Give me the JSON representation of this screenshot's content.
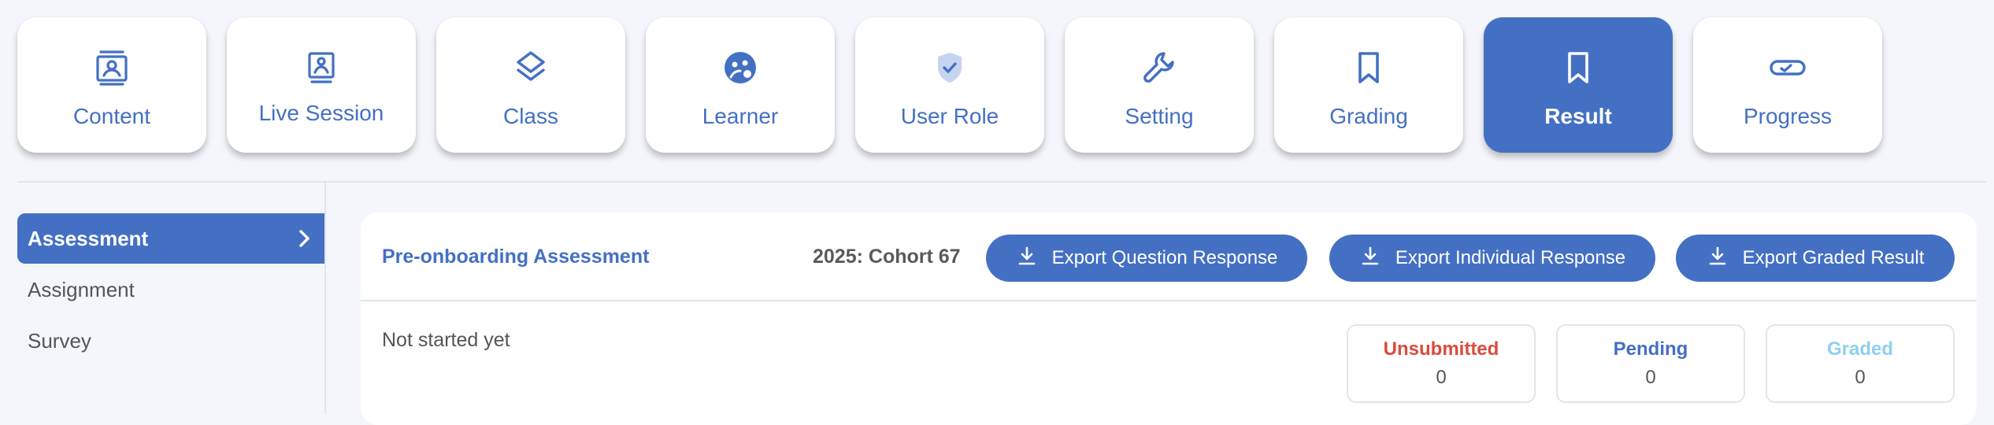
{
  "tabs": [
    {
      "label": "Content",
      "icon": "contacts-book-icon",
      "active": false
    },
    {
      "label": "Live Session",
      "icon": "presentation-user-icon",
      "active": false
    },
    {
      "label": "Class",
      "icon": "layers-icon",
      "active": false
    },
    {
      "label": "Learner",
      "icon": "learner-face-icon",
      "active": false
    },
    {
      "label": "User Role",
      "icon": "shield-check-icon",
      "active": false
    },
    {
      "label": "Setting",
      "icon": "wrench-icon",
      "active": false
    },
    {
      "label": "Grading",
      "icon": "bookmark-icon",
      "active": false
    },
    {
      "label": "Result",
      "icon": "bookmark-icon",
      "active": true
    },
    {
      "label": "Progress",
      "icon": "toggle-check-icon",
      "active": false
    }
  ],
  "sidebar": {
    "items": [
      {
        "label": "Assessment",
        "active": true
      },
      {
        "label": "Assignment",
        "active": false
      },
      {
        "label": "Survey",
        "active": false
      }
    ]
  },
  "assessment": {
    "title": "Pre-onboarding Assessment",
    "cohort": "2025: Cohort 67",
    "buttons": {
      "export_question": "Export Question Response",
      "export_individual": "Export Individual Response",
      "export_graded": "Export Graded Result"
    },
    "status": "Not started yet",
    "stats": {
      "unsubmitted": {
        "label": "Unsubmitted",
        "value": "0"
      },
      "pending": {
        "label": "Pending",
        "value": "0"
      },
      "graded": {
        "label": "Graded",
        "value": "0"
      }
    }
  },
  "colors": {
    "accent": "#4470c4",
    "background": "#f4f6fb",
    "unsubmitted": "#dc4a3d",
    "pending": "#4470c4",
    "graded": "#8ed0ef"
  }
}
